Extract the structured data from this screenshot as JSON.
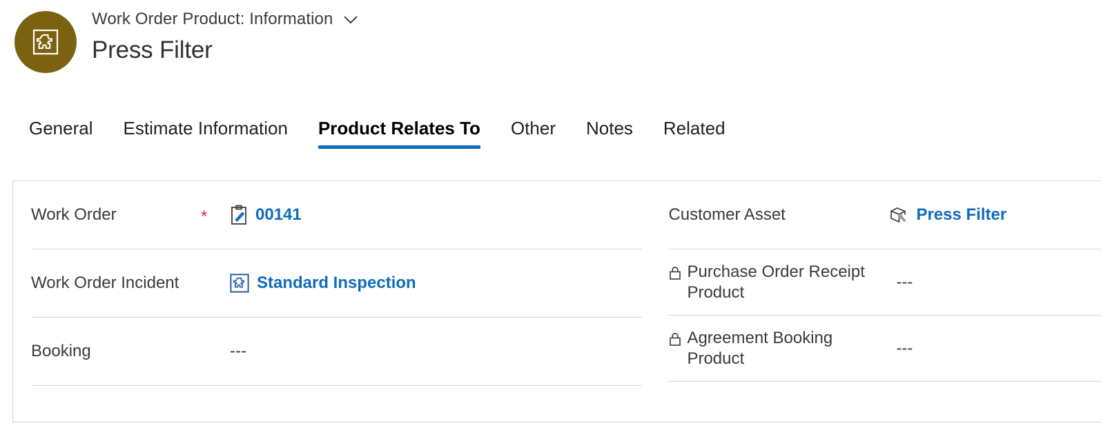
{
  "header": {
    "entity_label": "Work Order Product: Information",
    "record_title": "Press Filter",
    "avatar_icon": "product-puzzle-icon",
    "dropdown_icon": "chevron-down-icon",
    "avatar_color": "#7a6211"
  },
  "tabs": [
    {
      "label": "General",
      "active": false
    },
    {
      "label": "Estimate Information",
      "active": false
    },
    {
      "label": "Product Relates To",
      "active": true
    },
    {
      "label": "Other",
      "active": false
    },
    {
      "label": "Notes",
      "active": false
    },
    {
      "label": "Related",
      "active": false
    }
  ],
  "accent_color": "#0f6cbd",
  "required_color": "#d13438",
  "form": {
    "left_column": [
      {
        "label": "Work Order",
        "required": true,
        "required_marker": "*",
        "icon": "work-order-clipboard-icon",
        "value": "00141",
        "value_type": "link"
      },
      {
        "label": "Work Order Incident",
        "required": false,
        "icon": "incident-puzzle-icon",
        "value": "Standard Inspection",
        "value_type": "link"
      },
      {
        "label": "Booking",
        "required": false,
        "icon": null,
        "value": "---",
        "value_type": "empty"
      }
    ],
    "right_column": [
      {
        "label": "Customer Asset",
        "locked": false,
        "icon": "customer-asset-box-icon",
        "value": "Press Filter",
        "value_type": "link"
      },
      {
        "label": "Purchase Order Receipt Product",
        "locked": true,
        "lock_icon": "lock-icon",
        "icon": null,
        "value": "---",
        "value_type": "empty"
      },
      {
        "label": "Agreement Booking Product",
        "locked": true,
        "lock_icon": "lock-icon",
        "icon": null,
        "value": "---",
        "value_type": "empty"
      }
    ]
  }
}
